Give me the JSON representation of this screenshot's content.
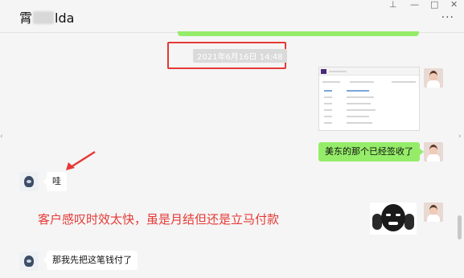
{
  "window": {
    "title_start": "霄",
    "title_end": "lda",
    "controls": {
      "pin": "⊥",
      "minimize": "—",
      "maximize": "□",
      "close": "✕"
    },
    "more": "···"
  },
  "chat": {
    "timestamp": "2021年6月16日 14:48",
    "messages": {
      "me_text": "美东的那个已经签收了",
      "other_reply_1": "哇",
      "other_reply_2": "那我先把这笔钱付了"
    },
    "annotation": "客户感叹时效太快，虽是月结但还是立马付款"
  },
  "colors": {
    "my_bubble": "#95ec69",
    "highlight_red": "#e53935",
    "background": "#f5f5f5"
  },
  "icons": {
    "annotation_arrow": "red-arrow-icon",
    "pin": "pin-icon",
    "more": "more-icon"
  }
}
